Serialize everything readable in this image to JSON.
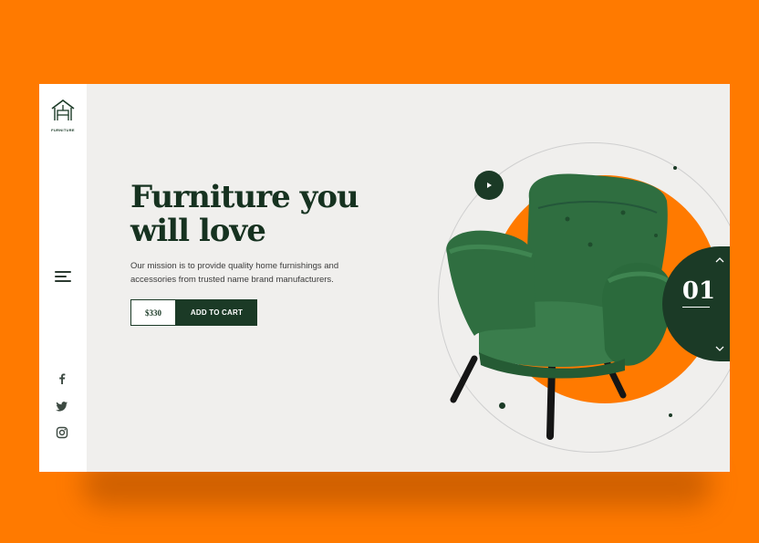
{
  "brand": {
    "logo_text": "FURNITURE",
    "icon": "home-furniture-icon"
  },
  "hero": {
    "headline_line1": "Furniture you",
    "headline_line2": "will love",
    "description": "Our mission is to provide quality home furnishings and accessories from trusted name brand manufacturers.",
    "price": "$330",
    "cta_label": "ADD TO CART"
  },
  "slider": {
    "current": "01"
  },
  "social": [
    "facebook-icon",
    "twitter-icon",
    "instagram-icon"
  ],
  "colors": {
    "background": "#ff7a00",
    "card": "#f0efed",
    "accent_dark": "#1b3a26",
    "chair_green": "#2e6b3e"
  }
}
